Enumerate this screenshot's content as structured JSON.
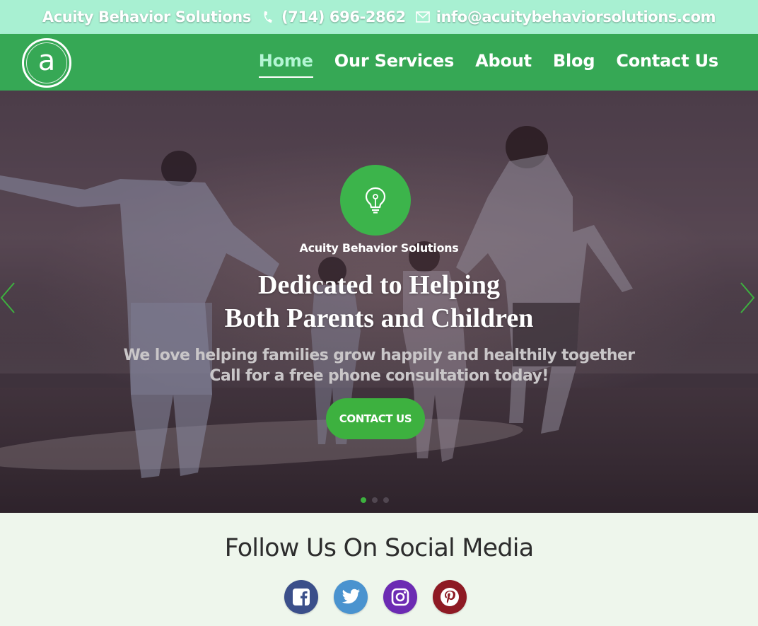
{
  "topbar": {
    "company": "Acuity Behavior Solutions",
    "phone": "(714) 696-2862",
    "email": "info@acuitybehaviorsolutions.com",
    "phone_icon": "phone-icon",
    "email_icon": "envelope-icon"
  },
  "header": {
    "logo_letter": "a",
    "nav": [
      {
        "label": "Home",
        "active": true
      },
      {
        "label": "Our Services"
      },
      {
        "label": "About"
      },
      {
        "label": "Blog"
      },
      {
        "label": "Contact Us"
      }
    ]
  },
  "hero": {
    "badge_icon": "lightbulb-icon",
    "subtitle": "Acuity Behavior Solutions",
    "title_line1": "Dedicated to Helping",
    "title_line2": "Both Parents and Children",
    "text_line1": "We love helping families grow happily and healthily together",
    "text_line2": "Call for a free phone consultation today!",
    "cta_label": "CONTACT US",
    "prev_icon": "chevron-left-icon",
    "next_icon": "chevron-right-icon"
  },
  "social": {
    "title": "Follow Us On Social Media",
    "icons": [
      {
        "name": "facebook-icon",
        "color": "#3b5998"
      },
      {
        "name": "twitter-icon",
        "color": "#4aa0d8"
      },
      {
        "name": "instagram-icon",
        "color": "#7a2db0"
      },
      {
        "name": "pinterest-icon",
        "color": "#9c1c26"
      }
    ]
  },
  "colors": {
    "topbar_bg": "#a8f0d2",
    "header_bg": "#36a855",
    "accent_green": "#3db13f",
    "nav_active": "#b3f5d4"
  }
}
